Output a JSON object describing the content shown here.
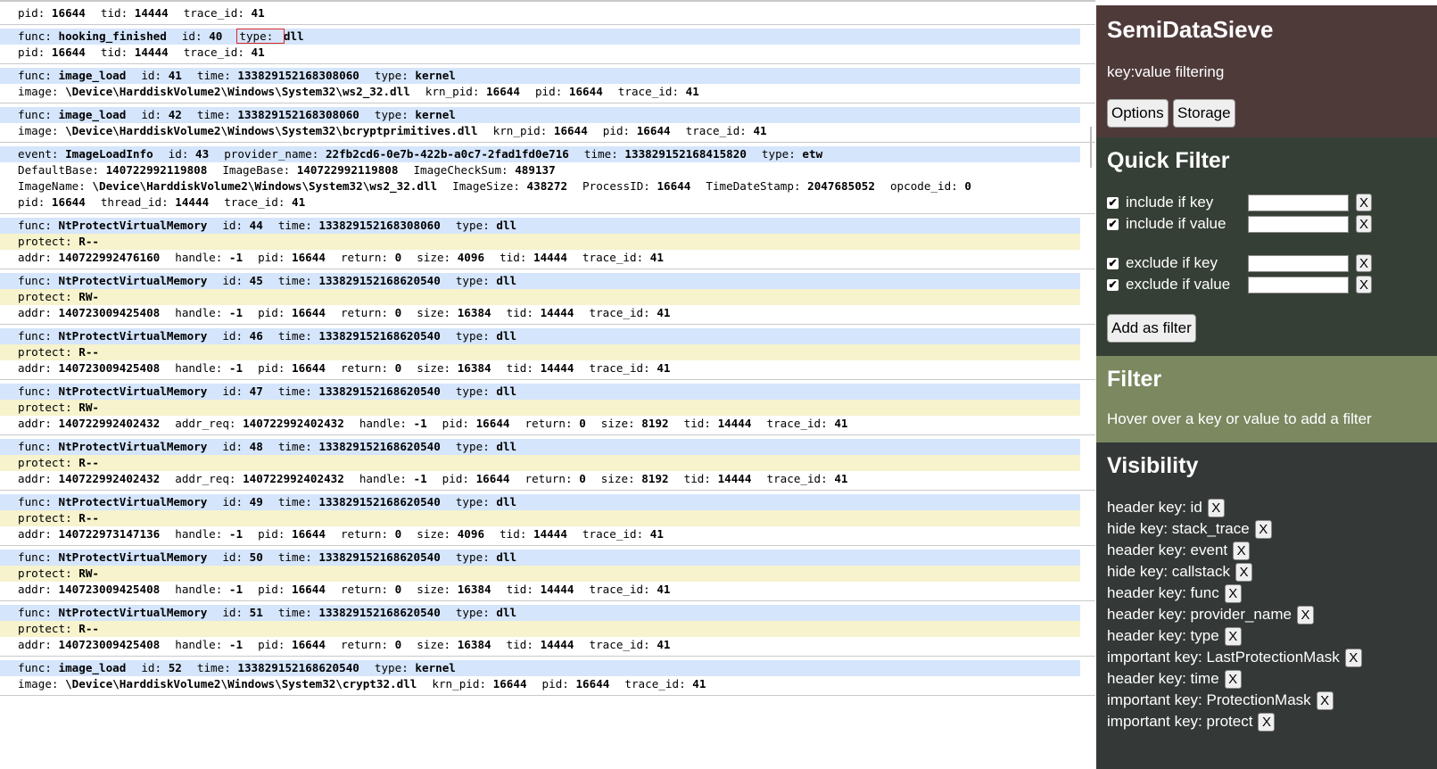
{
  "log": {
    "entries": [
      {
        "lines": [
          {
            "style": "plain",
            "pairs": [
              [
                "pid",
                "16644"
              ],
              [
                "tid",
                "14444"
              ],
              [
                "trace_id",
                "41"
              ]
            ]
          }
        ]
      },
      {
        "lines": [
          {
            "style": "hdr",
            "pairs": [
              [
                "func",
                "hooking_finished"
              ],
              [
                "id",
                "40"
              ],
              [
                "type",
                "dll"
              ]
            ]
          },
          {
            "style": "plain",
            "pairs": [
              [
                "pid",
                "16644"
              ],
              [
                "tid",
                "14444"
              ],
              [
                "trace_id",
                "41"
              ]
            ]
          }
        ]
      },
      {
        "lines": [
          {
            "style": "hdr",
            "pairs": [
              [
                "func",
                "image_load"
              ],
              [
                "id",
                "41"
              ],
              [
                "time",
                "133829152168308060"
              ],
              [
                "type",
                "kernel"
              ]
            ]
          },
          {
            "style": "plain",
            "pairs": [
              [
                "image",
                "\\Device\\HarddiskVolume2\\Windows\\System32\\ws2_32.dll"
              ],
              [
                "krn_pid",
                "16644"
              ],
              [
                "pid",
                "16644"
              ],
              [
                "trace_id",
                "41"
              ]
            ]
          }
        ]
      },
      {
        "lines": [
          {
            "style": "hdr",
            "pairs": [
              [
                "func",
                "image_load"
              ],
              [
                "id",
                "42"
              ],
              [
                "time",
                "133829152168308060"
              ],
              [
                "type",
                "kernel"
              ]
            ]
          },
          {
            "style": "plain",
            "pairs": [
              [
                "image",
                "\\Device\\HarddiskVolume2\\Windows\\System32\\bcryptprimitives.dll"
              ],
              [
                "krn_pid",
                "16644"
              ],
              [
                "pid",
                "16644"
              ],
              [
                "trace_id",
                "41"
              ]
            ]
          }
        ]
      },
      {
        "lines": [
          {
            "style": "hdr",
            "pairs": [
              [
                "event",
                "ImageLoadInfo"
              ],
              [
                "id",
                "43"
              ],
              [
                "provider_name",
                "22fb2cd6-0e7b-422b-a0c7-2fad1fd0e716"
              ],
              [
                "time",
                "133829152168415820"
              ],
              [
                "type",
                "etw"
              ]
            ]
          },
          {
            "style": "plain",
            "pairs": [
              [
                "DefaultBase",
                "140722992119808"
              ],
              [
                "ImageBase",
                "140722992119808"
              ],
              [
                "ImageCheckSum",
                "489137"
              ]
            ]
          },
          {
            "style": "plain",
            "pairs": [
              [
                "ImageName",
                "\\Device\\HarddiskVolume2\\Windows\\System32\\ws2_32.dll"
              ],
              [
                "ImageSize",
                "438272"
              ],
              [
                "ProcessID",
                "16644"
              ],
              [
                "TimeDateStamp",
                "2047685052"
              ],
              [
                "opcode_id",
                "0"
              ]
            ]
          },
          {
            "style": "plain",
            "pairs": [
              [
                "pid",
                "16644"
              ],
              [
                "thread_id",
                "14444"
              ],
              [
                "trace_id",
                "41"
              ]
            ]
          }
        ]
      },
      {
        "lines": [
          {
            "style": "hdr",
            "pairs": [
              [
                "func",
                "NtProtectVirtualMemory"
              ],
              [
                "id",
                "44"
              ],
              [
                "time",
                "133829152168308060"
              ],
              [
                "type",
                "dll"
              ]
            ]
          },
          {
            "style": "imp",
            "pairs": [
              [
                "protect",
                "R--"
              ]
            ]
          },
          {
            "style": "plain",
            "pairs": [
              [
                "addr",
                "140722992476160"
              ],
              [
                "handle",
                "-1"
              ],
              [
                "pid",
                "16644"
              ],
              [
                "return",
                "0"
              ],
              [
                "size",
                "4096"
              ],
              [
                "tid",
                "14444"
              ],
              [
                "trace_id",
                "41"
              ]
            ]
          }
        ]
      },
      {
        "lines": [
          {
            "style": "hdr",
            "pairs": [
              [
                "func",
                "NtProtectVirtualMemory"
              ],
              [
                "id",
                "45"
              ],
              [
                "time",
                "133829152168620540"
              ],
              [
                "type",
                "dll"
              ]
            ]
          },
          {
            "style": "imp",
            "pairs": [
              [
                "protect",
                "RW-"
              ]
            ]
          },
          {
            "style": "plain",
            "pairs": [
              [
                "addr",
                "140723009425408"
              ],
              [
                "handle",
                "-1"
              ],
              [
                "pid",
                "16644"
              ],
              [
                "return",
                "0"
              ],
              [
                "size",
                "16384"
              ],
              [
                "tid",
                "14444"
              ],
              [
                "trace_id",
                "41"
              ]
            ]
          }
        ]
      },
      {
        "lines": [
          {
            "style": "hdr",
            "pairs": [
              [
                "func",
                "NtProtectVirtualMemory"
              ],
              [
                "id",
                "46"
              ],
              [
                "time",
                "133829152168620540"
              ],
              [
                "type",
                "dll"
              ]
            ]
          },
          {
            "style": "imp",
            "pairs": [
              [
                "protect",
                "R--"
              ]
            ]
          },
          {
            "style": "plain",
            "pairs": [
              [
                "addr",
                "140723009425408"
              ],
              [
                "handle",
                "-1"
              ],
              [
                "pid",
                "16644"
              ],
              [
                "return",
                "0"
              ],
              [
                "size",
                "16384"
              ],
              [
                "tid",
                "14444"
              ],
              [
                "trace_id",
                "41"
              ]
            ]
          }
        ]
      },
      {
        "lines": [
          {
            "style": "hdr",
            "pairs": [
              [
                "func",
                "NtProtectVirtualMemory"
              ],
              [
                "id",
                "47"
              ],
              [
                "time",
                "133829152168620540"
              ],
              [
                "type",
                "dll"
              ]
            ]
          },
          {
            "style": "imp",
            "pairs": [
              [
                "protect",
                "RW-"
              ]
            ]
          },
          {
            "style": "plain",
            "pairs": [
              [
                "addr",
                "140722992402432"
              ],
              [
                "addr_req",
                "140722992402432"
              ],
              [
                "handle",
                "-1"
              ],
              [
                "pid",
                "16644"
              ],
              [
                "return",
                "0"
              ],
              [
                "size",
                "8192"
              ],
              [
                "tid",
                "14444"
              ],
              [
                "trace_id",
                "41"
              ]
            ]
          }
        ]
      },
      {
        "lines": [
          {
            "style": "hdr",
            "pairs": [
              [
                "func",
                "NtProtectVirtualMemory"
              ],
              [
                "id",
                "48"
              ],
              [
                "time",
                "133829152168620540"
              ],
              [
                "type",
                "dll"
              ]
            ]
          },
          {
            "style": "imp",
            "pairs": [
              [
                "protect",
                "R--"
              ]
            ]
          },
          {
            "style": "plain",
            "pairs": [
              [
                "addr",
                "140722992402432"
              ],
              [
                "addr_req",
                "140722992402432"
              ],
              [
                "handle",
                "-1"
              ],
              [
                "pid",
                "16644"
              ],
              [
                "return",
                "0"
              ],
              [
                "size",
                "8192"
              ],
              [
                "tid",
                "14444"
              ],
              [
                "trace_id",
                "41"
              ]
            ]
          }
        ]
      },
      {
        "lines": [
          {
            "style": "hdr",
            "pairs": [
              [
                "func",
                "NtProtectVirtualMemory"
              ],
              [
                "id",
                "49"
              ],
              [
                "time",
                "133829152168620540"
              ],
              [
                "type",
                "dll"
              ]
            ]
          },
          {
            "style": "imp",
            "pairs": [
              [
                "protect",
                "R--"
              ]
            ]
          },
          {
            "style": "plain",
            "pairs": [
              [
                "addr",
                "140722973147136"
              ],
              [
                "handle",
                "-1"
              ],
              [
                "pid",
                "16644"
              ],
              [
                "return",
                "0"
              ],
              [
                "size",
                "4096"
              ],
              [
                "tid",
                "14444"
              ],
              [
                "trace_id",
                "41"
              ]
            ]
          }
        ]
      },
      {
        "lines": [
          {
            "style": "hdr",
            "pairs": [
              [
                "func",
                "NtProtectVirtualMemory"
              ],
              [
                "id",
                "50"
              ],
              [
                "time",
                "133829152168620540"
              ],
              [
                "type",
                "dll"
              ]
            ]
          },
          {
            "style": "imp",
            "pairs": [
              [
                "protect",
                "RW-"
              ]
            ]
          },
          {
            "style": "plain",
            "pairs": [
              [
                "addr",
                "140723009425408"
              ],
              [
                "handle",
                "-1"
              ],
              [
                "pid",
                "16644"
              ],
              [
                "return",
                "0"
              ],
              [
                "size",
                "16384"
              ],
              [
                "tid",
                "14444"
              ],
              [
                "trace_id",
                "41"
              ]
            ]
          }
        ]
      },
      {
        "lines": [
          {
            "style": "hdr",
            "pairs": [
              [
                "func",
                "NtProtectVirtualMemory"
              ],
              [
                "id",
                "51"
              ],
              [
                "time",
                "133829152168620540"
              ],
              [
                "type",
                "dll"
              ]
            ]
          },
          {
            "style": "imp",
            "pairs": [
              [
                "protect",
                "R--"
              ]
            ]
          },
          {
            "style": "plain",
            "pairs": [
              [
                "addr",
                "140723009425408"
              ],
              [
                "handle",
                "-1"
              ],
              [
                "pid",
                "16644"
              ],
              [
                "return",
                "0"
              ],
              [
                "size",
                "16384"
              ],
              [
                "tid",
                "14444"
              ],
              [
                "trace_id",
                "41"
              ]
            ]
          }
        ]
      },
      {
        "lines": [
          {
            "style": "hdr",
            "pairs": [
              [
                "func",
                "image_load"
              ],
              [
                "id",
                "52"
              ],
              [
                "time",
                "133829152168620540"
              ],
              [
                "type",
                "kernel"
              ]
            ]
          },
          {
            "style": "plain",
            "pairs": [
              [
                "image",
                "\\Device\\HarddiskVolume2\\Windows\\System32\\crypt32.dll"
              ],
              [
                "krn_pid",
                "16644"
              ],
              [
                "pid",
                "16644"
              ],
              [
                "trace_id",
                "41"
              ]
            ]
          }
        ]
      }
    ]
  },
  "panel": {
    "title": "SemiDataSieve",
    "subtitle": "key:value filtering",
    "options_label": "Options",
    "storage_label": "Storage",
    "quick_filter": {
      "title": "Quick Filter",
      "rows": [
        {
          "label": "include if key",
          "checked": true
        },
        {
          "label": "include if value",
          "checked": true
        },
        {
          "label": "exclude if key",
          "checked": true
        },
        {
          "label": "exclude if value",
          "checked": true
        }
      ],
      "clear_label": "X",
      "add_label": "Add as filter"
    },
    "filter": {
      "title": "Filter",
      "hint": "Hover over a key or value to add a filter"
    },
    "visibility": {
      "title": "Visibility",
      "remove_label": "X",
      "items": [
        "header key: id",
        "hide key: stack_trace",
        "header key: event",
        "hide key: callstack",
        "header key: func",
        "header key: provider_name",
        "header key: type",
        "important key: LastProtectionMask",
        "header key: time",
        "important key: ProtectionMask",
        "important key: protect"
      ]
    }
  },
  "colors": {
    "header_row": "#d5e5fb",
    "important_row": "#f6f3cd",
    "panel_head": "#4f3a3a",
    "panel_quick": "#363f36",
    "panel_filter": "#7b8860",
    "panel_visibility": "#343837"
  },
  "icons": {
    "checkbox": "check-icon",
    "remove": "close-icon"
  }
}
